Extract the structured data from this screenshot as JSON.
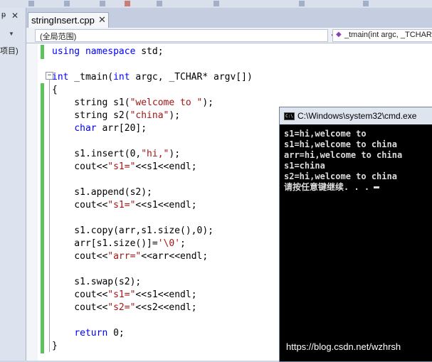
{
  "left_panel": {
    "pin_glyph": "ᵽ",
    "close_glyph": "✕",
    "item_label": "项目)"
  },
  "tab": {
    "label": "stringInsert.cpp",
    "close_glyph": "✕"
  },
  "nav": {
    "scope": "(全局范围)",
    "member": "_tmain(int argc, _TCHAR"
  },
  "code_lines": [
    "using namespace std;",
    "",
    "int _tmain(int argc, _TCHAR* argv[])",
    "{",
    "    string s1(\"welcome to \");",
    "    string s2(\"china\");",
    "    char arr[20];",
    "",
    "    s1.insert(0,\"hi,\");",
    "    cout<<\"s1=\"<<s1<<endl;",
    "",
    "    s1.append(s2);",
    "    cout<<\"s1=\"<<s1<<endl;",
    "",
    "    s1.copy(arr,s1.size(),0);",
    "    arr[s1.size()]='\\0';",
    "    cout<<\"arr=\"<<arr<<endl;",
    "",
    "    s1.swap(s2);",
    "    cout<<\"s1=\"<<s1<<endl;",
    "    cout<<\"s2=\"<<s2<<endl;",
    "",
    "    return 0;",
    "}"
  ],
  "console": {
    "title": "C:\\Windows\\system32\\cmd.exe",
    "lines": [
      "s1=hi,welcome to",
      "s1=hi,welcome to china",
      "arr=hi,welcome to china",
      "s1=china",
      "s2=hi,welcome to china"
    ],
    "prompt": "请按任意键继续. . ."
  },
  "watermark": "https://blog.csdn.net/wzhrsh"
}
